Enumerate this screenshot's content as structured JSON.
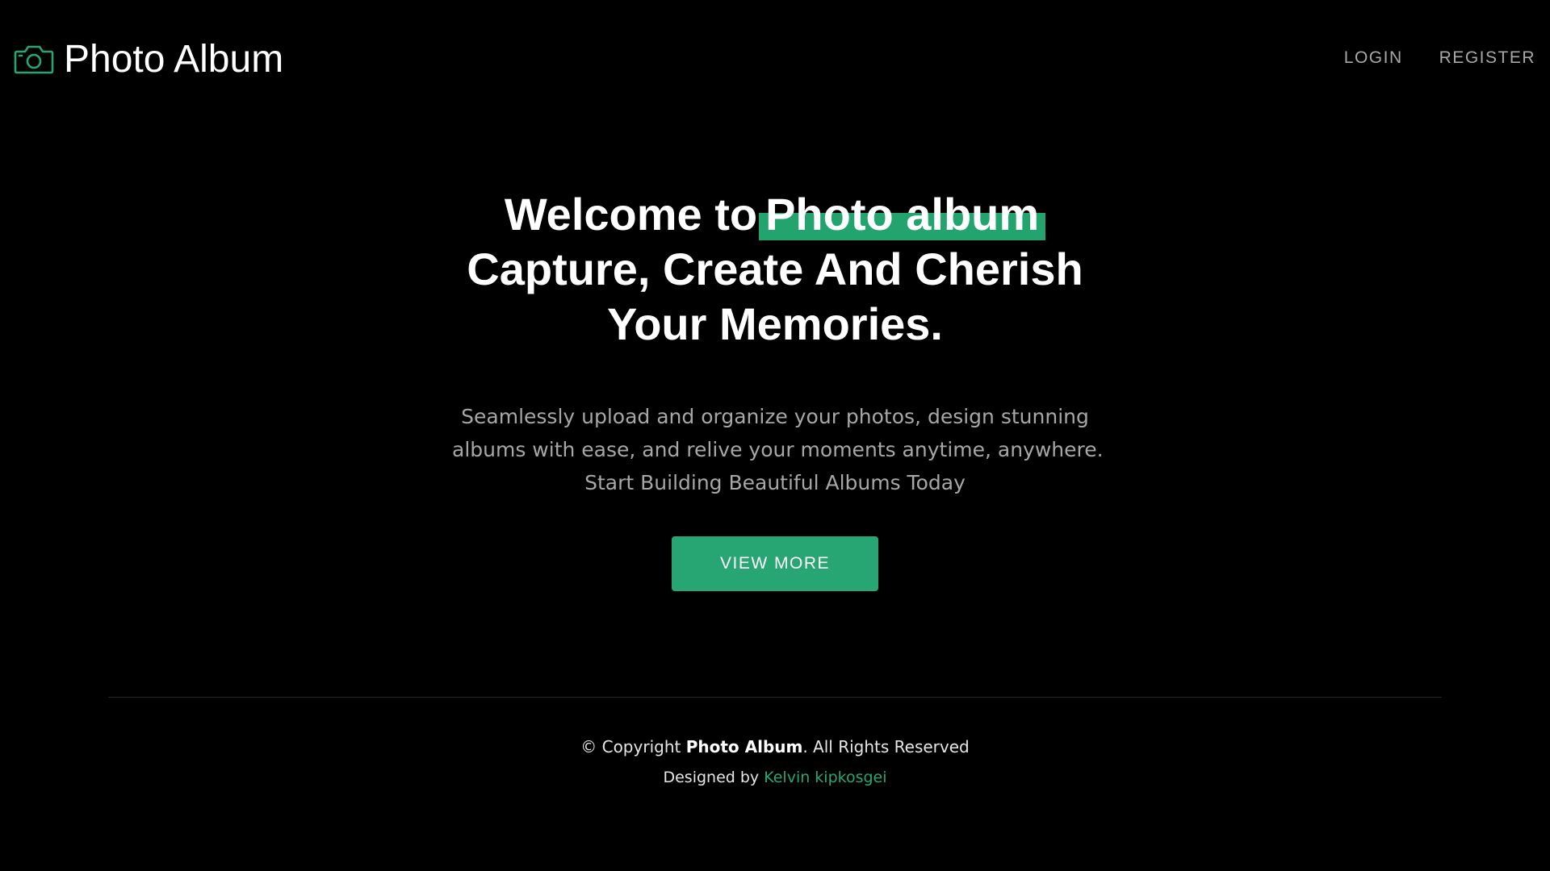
{
  "header": {
    "brand_icon": "camera-icon",
    "brand_name": "Photo Album",
    "nav": {
      "login": "LOGIN",
      "register": "REGISTER"
    }
  },
  "hero": {
    "title_prefix": "Welcome to",
    "title_highlight": "Photo album",
    "title_line2": "Capture, Create And Cherish",
    "title_line3": "Your Memories.",
    "subtitle_line1": "Seamlessly upload and organize your photos, design stunning",
    "subtitle_line2": "albums with ease, and relive your moments anytime, anywhere.",
    "subtitle_line3": "Start Building Beautiful Albums Today",
    "cta_label": "VIEW MORE"
  },
  "footer": {
    "copyright_prefix": "© Copyright",
    "copyright_brand": "Photo Album",
    "copyright_suffix": ". All Rights Reserved",
    "designed_by": "Designed by",
    "designer_name": "Kelvin kipkosgei"
  },
  "colors": {
    "background": "#000000",
    "accent": "#27a673",
    "text_primary": "#ffffff",
    "text_muted": "#a7a7a7"
  }
}
